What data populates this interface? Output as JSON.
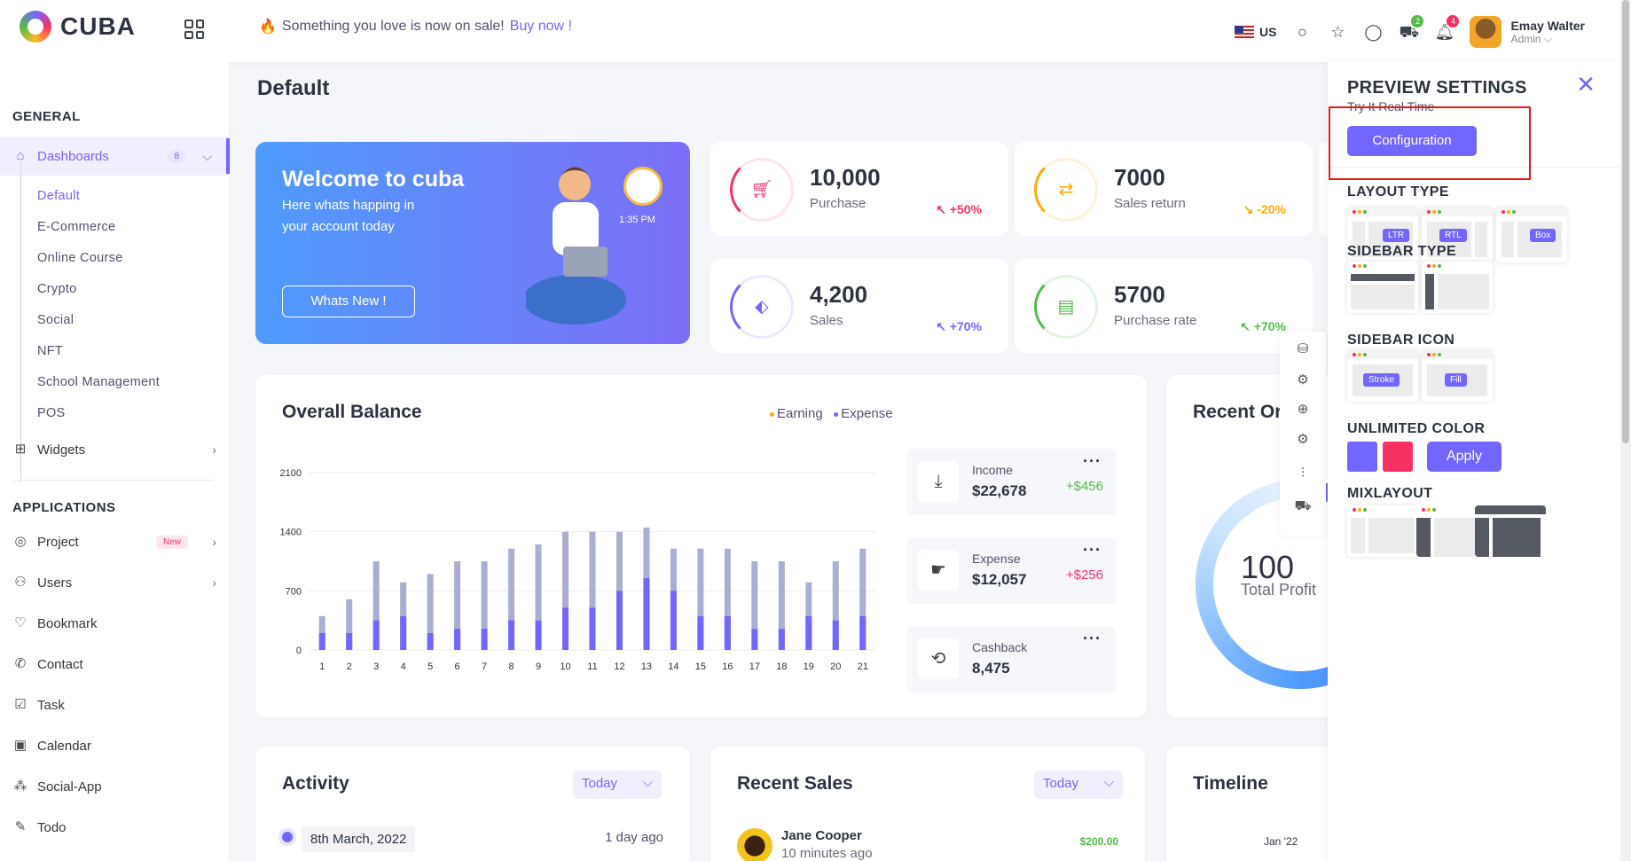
{
  "header": {
    "logo": "CUBA",
    "promo_text": "Something you love is now on sale!",
    "promo_link": "Buy now !",
    "lang": "US",
    "cart_badge": "2",
    "bell_badge": "4",
    "user_name": "Emay Walter",
    "user_role": "Admin ⌵"
  },
  "sidebar": {
    "general_title": "GENERAL",
    "dashboards_label": "Dashboards",
    "dashboards_count": "8",
    "submenu": [
      "Default",
      "E-Commerce",
      "Online Course",
      "Crypto",
      "Social",
      "NFT",
      "School Management",
      "POS"
    ],
    "widgets_label": "Widgets",
    "applications_title": "APPLICATIONS",
    "items": [
      {
        "label": "Project",
        "tag": "New"
      },
      {
        "label": "Users"
      },
      {
        "label": "Bookmark"
      },
      {
        "label": "Contact"
      },
      {
        "label": "Task"
      },
      {
        "label": "Calendar"
      },
      {
        "label": "Social-App"
      },
      {
        "label": "Todo"
      }
    ]
  },
  "page": {
    "title": "Default"
  },
  "welcome": {
    "title": "Welcome to cuba",
    "subtitle": "Here whats happing in your account today",
    "button": "Whats New !",
    "clock_time": "1:35 PM"
  },
  "stats": [
    {
      "value": "10,000",
      "label": "Purchase",
      "change": "↖ +50%",
      "color": "#f73164"
    },
    {
      "value": "7000",
      "label": "Sales return",
      "change": "↘ -20%",
      "color": "#ffaa05"
    },
    {
      "value": "4,200",
      "label": "Sales",
      "change": "↖ +70%",
      "color": "#7366ff"
    },
    {
      "value": "5700",
      "label": "Purchase rate",
      "change": "↖ +70%",
      "color": "#54ba4a"
    }
  ],
  "balance": {
    "title": "Overall Balance",
    "legend": [
      "Earning",
      "Expense"
    ],
    "income_label": "Income",
    "income_value": "$22,678",
    "income_change": "+$456",
    "expense_label": "Expense",
    "expense_value": "$12,057",
    "expense_change": "+$256",
    "cashback_label": "Cashback",
    "cashback_value": "8,475",
    "more": "···"
  },
  "chart_data": {
    "type": "bar",
    "categories": [
      "1",
      "2",
      "3",
      "4",
      "5",
      "6",
      "7",
      "8",
      "9",
      "10",
      "11",
      "12",
      "13",
      "14",
      "15",
      "16",
      "17",
      "18",
      "19",
      "20",
      "21"
    ],
    "series": [
      {
        "name": "Earning",
        "values": [
          400,
          600,
          1050,
          800,
          900,
          1050,
          1050,
          1200,
          1250,
          1400,
          1400,
          1400,
          1450,
          1200,
          1200,
          1200,
          1050,
          1050,
          800,
          1050,
          1200
        ]
      },
      {
        "name": "Expense",
        "values": [
          200,
          200,
          350,
          400,
          200,
          250,
          250,
          350,
          350,
          500,
          500,
          700,
          850,
          700,
          400,
          400,
          250,
          250,
          400,
          350,
          400
        ]
      }
    ],
    "ylim": [
      0,
      2100
    ],
    "yticks": [
      "2100",
      "1400",
      "700",
      "0"
    ],
    "colors": {
      "earning": "#a9aed3",
      "expense": "#7366ff"
    }
  },
  "recent": {
    "title": "Recent Or",
    "value": "100",
    "label": "Total Profit"
  },
  "activity": {
    "title": "Activity",
    "filter": "Today",
    "date": "8th March, 2022",
    "ago": "1 day ago"
  },
  "sales": {
    "title": "Recent Sales",
    "filter": "Today",
    "name": "Jane Cooper",
    "time": "10 minutes ago",
    "amount": "$200.00"
  },
  "timeline": {
    "title": "Timeline",
    "month": "Jan '22"
  },
  "panel": {
    "title": "PREVIEW SETTINGS",
    "subtitle": "Try It Real Time",
    "config_btn": "Configuration",
    "layout_type": "LAYOUT TYPE",
    "layout_opts": [
      "LTR",
      "RTL",
      "Box"
    ],
    "sidebar_type": "SIDEBAR TYPE",
    "sidebar_icon": "SIDEBAR ICON",
    "icon_opts": [
      "Stroke",
      "Fill"
    ],
    "unlimited_color": "UNLIMITED COLOR",
    "apply": "Apply",
    "mixlayout": "MIXLAYOUT",
    "swatches": [
      "#7366ff",
      "#f73164"
    ]
  }
}
